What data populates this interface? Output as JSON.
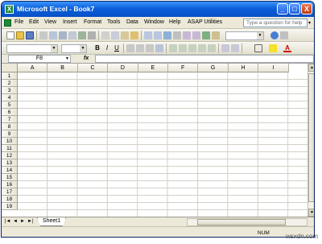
{
  "window": {
    "title": "Microsoft Excel - Book7",
    "app_letter": "X"
  },
  "title_controls": {
    "minimize": "_",
    "maximize": "□",
    "close": "X"
  },
  "menu": {
    "items": [
      "File",
      "Edit",
      "View",
      "Insert",
      "Format",
      "Tools",
      "Data",
      "Window",
      "Help",
      "ASAP Utilities"
    ],
    "help_placeholder": "Type a question for help",
    "help_arrow": "▾"
  },
  "formula_bar": {
    "name_box": "F8",
    "fx_label": "fx",
    "formula": ""
  },
  "sheet": {
    "columns": [
      "A",
      "B",
      "C",
      "D",
      "E",
      "F",
      "G",
      "H",
      "I"
    ],
    "rows": [
      "1",
      "2",
      "3",
      "4",
      "5",
      "6",
      "7",
      "8",
      "9",
      "10",
      "11",
      "12",
      "13",
      "14",
      "15",
      "16",
      "17",
      "18",
      "19"
    ]
  },
  "tabs": {
    "nav": [
      "|◄",
      "◄",
      "►",
      "►|"
    ],
    "sheets": [
      "Sheet1"
    ]
  },
  "status": {
    "num": "NUM"
  },
  "watermark": "wsxdn.com",
  "colors": {
    "title_bar": "#0a5fd8",
    "chrome": "#ece9d8",
    "grid": "#d4d0c8"
  }
}
